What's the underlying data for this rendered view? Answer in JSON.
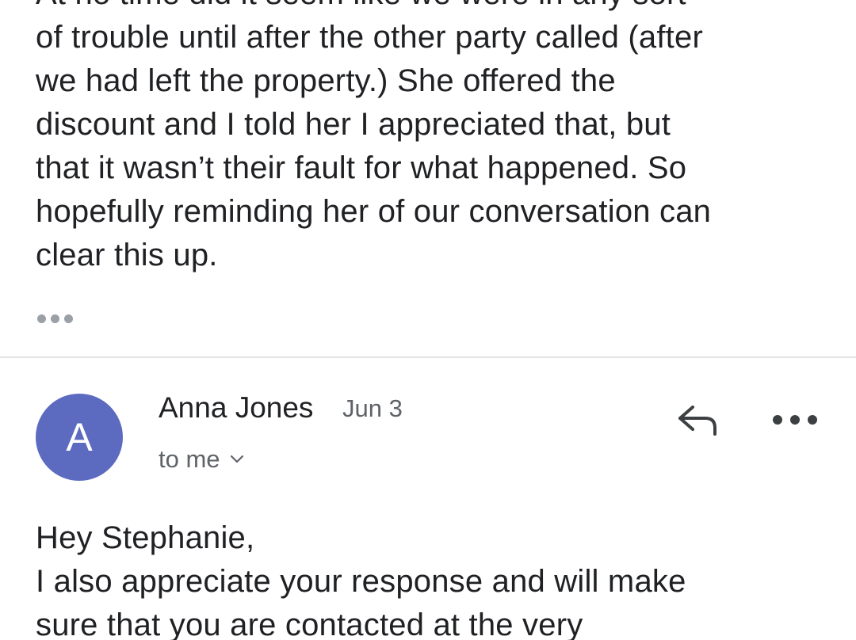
{
  "previous_message": {
    "lines": [
      "At no time did it seem like we were in any sort",
      "of trouble until after the other party called (after",
      "we had left the property.) She offered the",
      "discount and I told her I appreciated that, but",
      "that it wasn’t their fault for what happened. So",
      "hopefully reminding her of our conversation can",
      "clear this up."
    ],
    "trimmed_content_icon": "more-horiz-icon"
  },
  "message": {
    "avatar_letter": "A",
    "avatar_color": "#5c6bc0",
    "sender": "Anna Jones",
    "date": "Jun 3",
    "recipients": "to me",
    "recipients_icon": "chevron-down-icon",
    "reply_icon": "reply-icon",
    "more_icon": "more-horiz-icon",
    "body_lines": [
      "Hey Stephanie,",
      "I also appreciate your response and will make",
      "sure that you are contacted at the very"
    ]
  }
}
